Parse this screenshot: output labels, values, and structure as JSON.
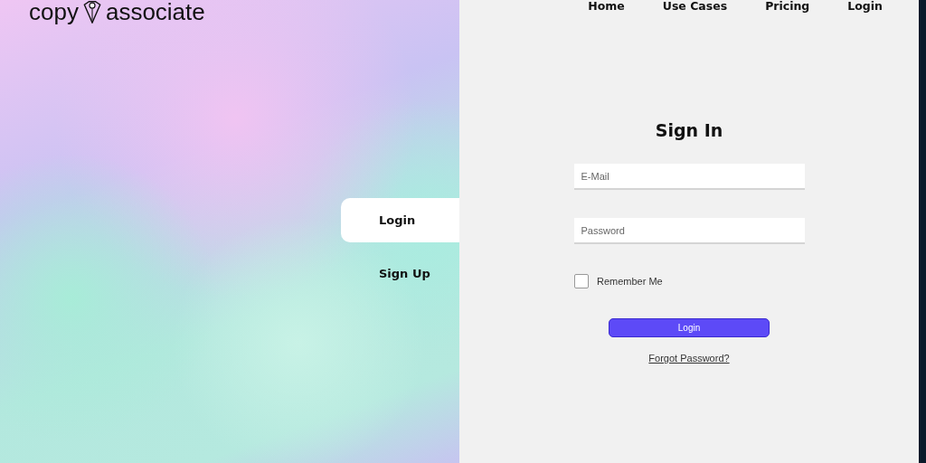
{
  "logo": {
    "word_1": "copy",
    "word_2": "associate"
  },
  "nav": [
    {
      "label": "Home"
    },
    {
      "label": "Use Cases"
    },
    {
      "label": "Pricing"
    },
    {
      "label": "Login"
    }
  ],
  "side_tabs": [
    {
      "label": "Login",
      "selected": true
    },
    {
      "label": "Sign Up",
      "selected": false
    }
  ],
  "form": {
    "title": "Sign In",
    "fields": [
      {
        "placeholder": "E-Mail"
      },
      {
        "placeholder": "Password"
      }
    ],
    "remember": {
      "label": "Remember Me",
      "checked": false
    },
    "submit": "Login",
    "forgot": "Forgot Password?"
  }
}
